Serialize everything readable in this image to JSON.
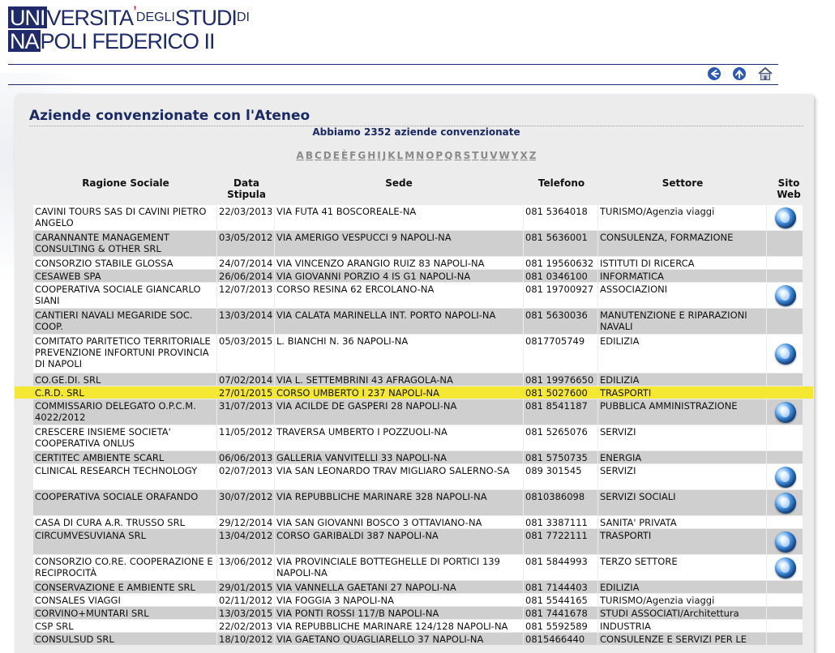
{
  "logo": {
    "line1_box": "UNI",
    "line1_text_a": "VERSITA",
    "line1_apos": "’",
    "line1_small": "DEGLI",
    "line1_text_b": " STUDI ",
    "line1_small2": "DI",
    "line2_box": "NA",
    "line2_text": "POLI FEDERICO II"
  },
  "nav": {
    "back_icon": "arrow-left-icon",
    "up_icon": "arrow-up-icon",
    "home_icon": "home-icon"
  },
  "page": {
    "title": "Aziende convenzionate con l'Ateneo",
    "count_text": "Abbiamo 2352 aziende convenzionate"
  },
  "alphabet": [
    "A",
    "B",
    "C",
    "D",
    "E",
    "È",
    "F",
    "G",
    "H",
    "I",
    "J",
    "K",
    "L",
    "M",
    "N",
    "O",
    "P",
    "Q",
    "R",
    "S",
    "T",
    "U",
    "V",
    "W",
    "Y",
    "X",
    "Z"
  ],
  "table": {
    "headers": {
      "ragione": "Ragione Sociale",
      "data_line1": "Data",
      "data_line2": "Stipula",
      "sede": "Sede",
      "telefono": "Telefono",
      "settore": "Settore",
      "sito_line1": "Sito",
      "sito_line2": "Web"
    },
    "rows": [
      {
        "ragione": "CAVINI TOURS SAS DI CAVINI PIETRO ANGELO",
        "data": "22/03/2013",
        "sede": "VIA FUTA 41 BOSCOREALE-NA",
        "tel": "081 5364018",
        "settore": "TURISMO/Agenzia viaggi",
        "web": true,
        "lines": 2
      },
      {
        "ragione": "CARANNANTE MANAGEMENT CONSULTING & OTHER SRL",
        "data": "03/05/2012",
        "sede": "VIA AMERIGO VESPUCCI 9 NAPOLI-NA",
        "tel": "081 5636001",
        "settore": "CONSULENZA, FORMAZIONE",
        "web": false,
        "lines": 2
      },
      {
        "ragione": "CONSORZIO STABILE GLOSSA",
        "data": "24/07/2014",
        "sede": "VIA VINCENZO ARANGIO RUIZ 83 NAPOLI-NA",
        "tel": "081 19560632",
        "settore": "ISTITUTI DI RICERCA",
        "web": false,
        "lines": 1
      },
      {
        "ragione": "CESAWEB SPA",
        "data": "26/06/2014",
        "sede": "VIA GIOVANNI PORZIO 4 IS G1 NAPOLI-NA",
        "tel": "081 0346100",
        "settore": "INFORMATICA",
        "web": false,
        "lines": 1
      },
      {
        "ragione": "COOPERATIVA SOCIALE GIANCARLO SIANI",
        "data": "12/07/2013",
        "sede": "CORSO RESINA 62 ERCOLANO-NA",
        "tel": "081 19700927",
        "settore": "ASSOCIAZIONI",
        "web": true,
        "lines": 2
      },
      {
        "ragione": "CANTIERI NAVALI MEGARIDE SOC. COOP.",
        "data": "13/03/2014",
        "sede": "VIA CALATA MARINELLA INT. PORTO NAPOLI-NA",
        "tel": "081 5630036",
        "settore": "MANUTENZIONE E RIPARAZIONI NAVALI",
        "web": false,
        "lines": 2
      },
      {
        "ragione": "COMITATO PARITETICO TERRITORIALE PREVENZIONE INFORTUNI PROVINCIA DI NAPOLI",
        "data": "05/03/2015",
        "sede": "L. BIANCHI N. 36 NAPOLI-NA",
        "tel": "0817705749",
        "settore": "EDILIZIA",
        "web": true,
        "lines": 3
      },
      {
        "ragione": "CO.GE.DI. SRL",
        "data": "07/02/2014",
        "sede": "VIA L. SETTEMBRINI 43 AFRAGOLA-NA",
        "tel": "081 19976650",
        "settore": "EDILIZIA",
        "web": false,
        "lines": 1
      },
      {
        "ragione": "C.R.D. SRL",
        "data": "27/01/2015",
        "sede": "CORSO UMBERTO I 237 NAPOLI-NA",
        "tel": "081 5027600",
        "settore": "TRASPORTI",
        "web": false,
        "lines": 1,
        "highlight": true
      },
      {
        "ragione": "COMMISSARIO DELEGATO O.P.C.M. 4022/2012",
        "data": "31/07/2013",
        "sede": "VIA ACILDE DE GASPERI 28 NAPOLI-NA",
        "tel": "081 8541187",
        "settore": "PUBBLICA AMMINISTRAZIONE",
        "web": true,
        "lines": 2
      },
      {
        "ragione": "CRESCERE INSIEME SOCIETA' COOPERATIVA ONLUS",
        "data": "11/05/2012",
        "sede": "TRAVERSA UMBERTO I POZZUOLI-NA",
        "tel": "081 5265076",
        "settore": "SERVIZI",
        "web": false,
        "lines": 2
      },
      {
        "ragione": "CERTITEC AMBIENTE SCARL",
        "data": "06/06/2013",
        "sede": "GALLERIA VANVITELLI 33 NAPOLI-NA",
        "tel": "081 5750735",
        "settore": "ENERGIA",
        "web": false,
        "lines": 1
      },
      {
        "ragione": "CLINICAL RESEARCH TECHNOLOGY",
        "data": "02/07/2013",
        "sede": "VIA SAN LEONARDO TRAV MIGLIARO SALERNO-SA",
        "tel": "089 301545",
        "settore": "SERVIZI",
        "web": true,
        "lines": 2
      },
      {
        "ragione": "COOPERATIVA SOCIALE ORAFANDO",
        "data": "30/07/2012",
        "sede": "VIA REPUBBLICHE MARINARE 328 NAPOLI-NA",
        "tel": "0810386098",
        "settore": "SERVIZI SOCIALI",
        "web": true,
        "lines": 2
      },
      {
        "ragione": "CASA DI CURA A.R. TRUSSO SRL",
        "data": "29/12/2014",
        "sede": "VIA SAN GIOVANNI BOSCO 3 OTTAVIANO-NA",
        "tel": "081 3387111",
        "settore": "SANITA' PRIVATA",
        "web": false,
        "lines": 1
      },
      {
        "ragione": "CIRCUMVESUVIANA SRL",
        "data": "13/04/2012",
        "sede": "CORSO GARIBALDI 387 NAPOLI-NA",
        "tel": "081 7722111",
        "settore": "TRASPORTI",
        "web": true,
        "lines": 2
      },
      {
        "ragione": "CONSORZIO CO.RE. COOPERAZIONE E RECIPROCITÀ",
        "data": "13/06/2012",
        "sede": "VIA PROVINCIALE BOTTEGHELLE DI PORTICI 139 NAPOLI-NA",
        "tel": "081 5844993",
        "settore": "TERZO SETTORE",
        "web": true,
        "lines": 2
      },
      {
        "ragione": "CONSERVAZIONE E AMBIENTE SRL",
        "data": "29/01/2015",
        "sede": "VIA VANNELLA GAETANI 27 NAPOLI-NA",
        "tel": "081 7144403",
        "settore": "EDILIZIA",
        "web": false,
        "lines": 1
      },
      {
        "ragione": "CONSALES VIAGGI",
        "data": "02/11/2012",
        "sede": "VIA FOGGIA 3 NAPOLI-NA",
        "tel": "081 5544165",
        "settore": "TURISMO/Agenzia viaggi",
        "web": false,
        "lines": 1
      },
      {
        "ragione": "CORVINO+MUNTARI SRL",
        "data": "13/03/2015",
        "sede": "VIA PONTI ROSSI 117/B NAPOLI-NA",
        "tel": "081 7441678",
        "settore": "STUDI ASSOCIATI/Architettura",
        "web": false,
        "lines": 1
      },
      {
        "ragione": "CSP SRL",
        "data": "22/02/2013",
        "sede": "VIA REPUBBLICHE MARINARE 124/128 NAPOLI-NA",
        "tel": "081 5592589",
        "settore": "INDUSTRIA",
        "web": false,
        "lines": 1
      },
      {
        "ragione": "CONSULSUD SRL",
        "data": "18/10/2012",
        "sede": "VIA GAETANO QUAGLIARELLO 37 NAPOLI-NA",
        "tel": "0815466440",
        "settore": "CONSULENZE E SERVIZI PER LE",
        "web": false,
        "lines": 1
      }
    ]
  }
}
